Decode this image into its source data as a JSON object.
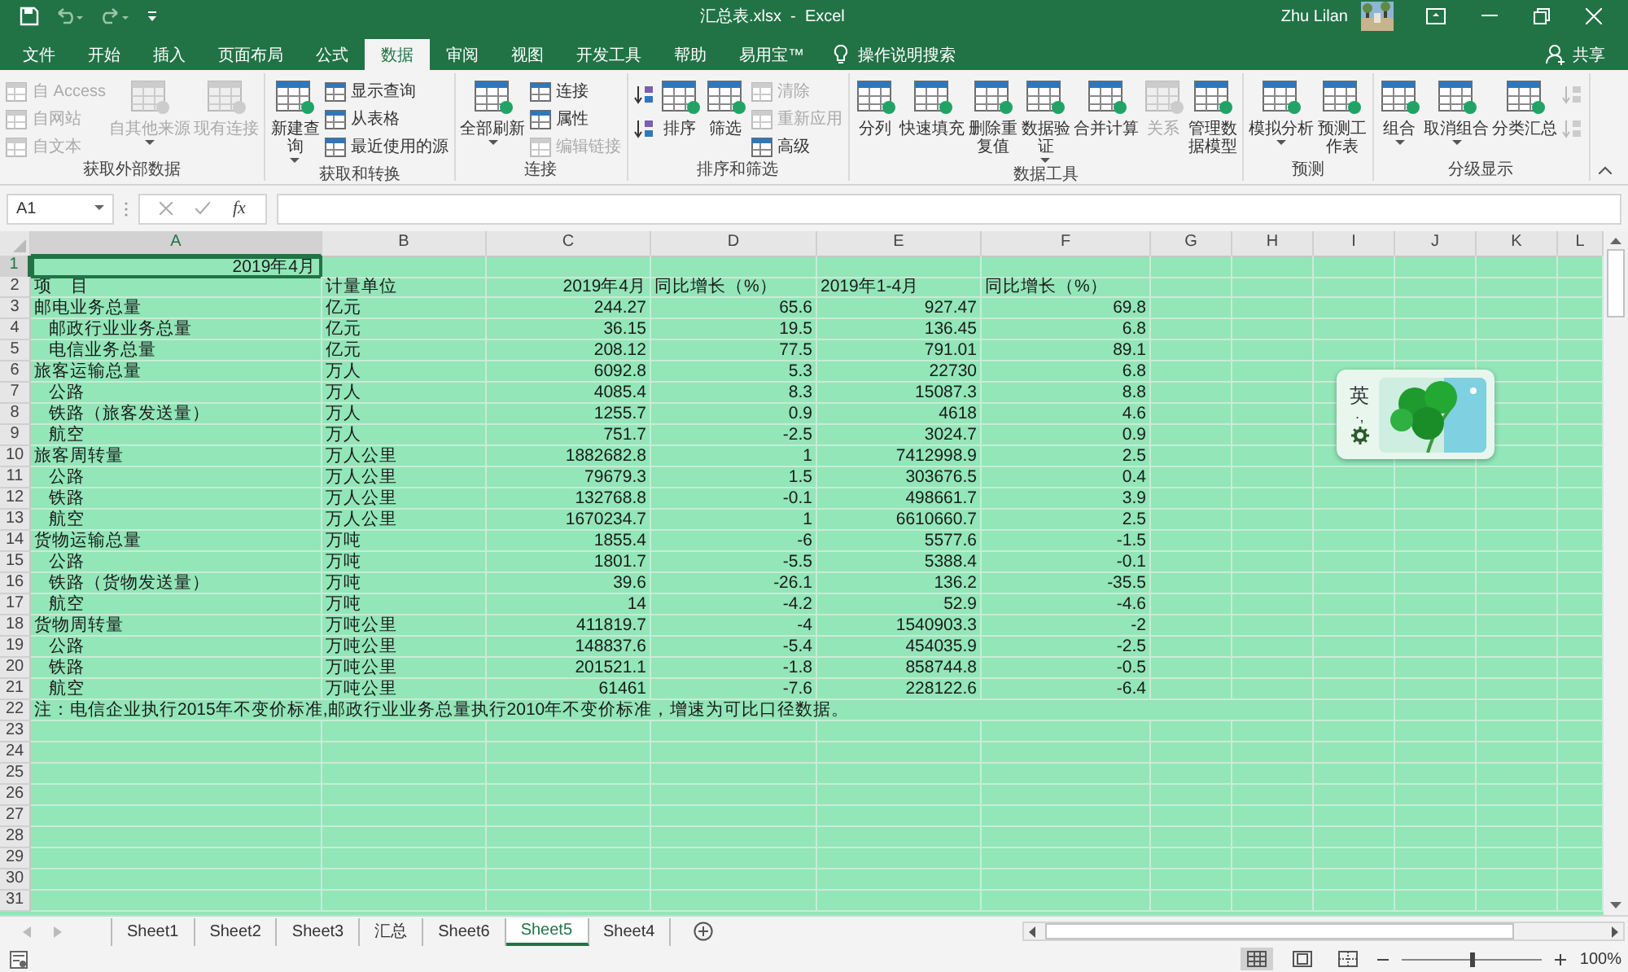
{
  "window": {
    "title": "汇总表.xlsx  -  Excel",
    "user": "Zhu Lilan"
  },
  "ribbon_tabs": [
    {
      "label": "文件",
      "selected": false
    },
    {
      "label": "开始",
      "selected": false
    },
    {
      "label": "插入",
      "selected": false
    },
    {
      "label": "页面布局",
      "selected": false
    },
    {
      "label": "公式",
      "selected": false
    },
    {
      "label": "数据",
      "selected": true
    },
    {
      "label": "审阅",
      "selected": false
    },
    {
      "label": "视图",
      "selected": false
    },
    {
      "label": "开发工具",
      "selected": false
    },
    {
      "label": "帮助",
      "selected": false
    },
    {
      "label": "易用宝™",
      "selected": false
    }
  ],
  "tell_me": "操作说明搜索",
  "share": "共享",
  "ribbon_groups": [
    {
      "label": "获取外部数据",
      "columns": [
        [
          {
            "label": "自 Access",
            "kind": "small",
            "disabled": true
          },
          {
            "label": "自网站",
            "kind": "small",
            "disabled": true
          },
          {
            "label": "自文本",
            "kind": "small",
            "disabled": true
          }
        ],
        [
          {
            "label": "自其他来源",
            "kind": "large",
            "disabled": true,
            "dropdown": true
          }
        ],
        [
          {
            "label": "现有连接",
            "kind": "large",
            "disabled": true
          }
        ]
      ]
    },
    {
      "label": "获取和转换",
      "columns": [
        [
          {
            "label": "新建查询",
            "kind": "large",
            "disabled": false,
            "dropdown": true,
            "wrap": true
          }
        ],
        [
          {
            "label": "显示查询",
            "kind": "small",
            "disabled": false
          },
          {
            "label": "从表格",
            "kind": "small",
            "disabled": false
          },
          {
            "label": "最近使用的源",
            "kind": "small",
            "disabled": false
          }
        ]
      ]
    },
    {
      "label": "连接",
      "columns": [
        [
          {
            "label": "全部刷新",
            "kind": "large",
            "disabled": false,
            "dropdown": true
          }
        ],
        [
          {
            "label": "连接",
            "kind": "small",
            "disabled": false
          },
          {
            "label": "属性",
            "kind": "small",
            "disabled": false
          },
          {
            "label": "编辑链接",
            "kind": "small",
            "disabled": true
          }
        ]
      ]
    },
    {
      "label": "排序和筛选",
      "columns": [
        [
          {
            "kind": "icon",
            "disabled": false
          },
          {
            "kind": "icon",
            "disabled": false
          }
        ],
        [
          {
            "label": "排序",
            "kind": "large",
            "disabled": false
          }
        ],
        [
          {
            "label": "筛选",
            "kind": "large",
            "disabled": false
          }
        ],
        [
          {
            "label": "清除",
            "kind": "small",
            "disabled": true
          },
          {
            "label": "重新应用",
            "kind": "small",
            "disabled": true
          },
          {
            "label": "高级",
            "kind": "small",
            "disabled": false
          }
        ]
      ]
    },
    {
      "label": "数据工具",
      "columns": [
        [
          {
            "label": "分列",
            "kind": "large",
            "disabled": false
          }
        ],
        [
          {
            "label": "快速填充",
            "kind": "large",
            "disabled": false
          }
        ],
        [
          {
            "label": "删除重复值",
            "kind": "large",
            "disabled": false,
            "wrap": true
          }
        ],
        [
          {
            "label": "数据验证",
            "kind": "large",
            "disabled": false,
            "dropdown": true,
            "wrap": true
          }
        ],
        [
          {
            "label": "合并计算",
            "kind": "large",
            "disabled": false
          }
        ],
        [
          {
            "label": "关系",
            "kind": "large",
            "disabled": true
          }
        ],
        [
          {
            "label": "管理数据模型",
            "kind": "large",
            "disabled": false,
            "wrap": true
          }
        ]
      ]
    },
    {
      "label": "预测",
      "columns": [
        [
          {
            "label": "模拟分析",
            "kind": "large",
            "disabled": false,
            "dropdown": true
          }
        ],
        [
          {
            "label": "预测工作表",
            "kind": "large",
            "disabled": false,
            "wrap": true
          }
        ]
      ]
    },
    {
      "label": "分级显示",
      "columns": [
        [
          {
            "label": "组合",
            "kind": "large",
            "disabled": false,
            "dropdown": true
          }
        ],
        [
          {
            "label": "取消组合",
            "kind": "large",
            "disabled": false,
            "dropdown": true
          }
        ],
        [
          {
            "label": "分类汇总",
            "kind": "large",
            "disabled": false
          }
        ],
        [
          {
            "kind": "icon",
            "disabled": true
          },
          {
            "kind": "icon",
            "disabled": true
          }
        ]
      ]
    }
  ],
  "formula_bar": {
    "name_box": "A1",
    "function_label": "fx"
  },
  "sheet": {
    "columns": [
      {
        "label": "A",
        "selected": true
      },
      {
        "label": "B",
        "selected": false
      },
      {
        "label": "C",
        "selected": false
      },
      {
        "label": "D",
        "selected": false
      },
      {
        "label": "E",
        "selected": false
      },
      {
        "label": "F",
        "selected": false
      },
      {
        "label": "G",
        "selected": false
      },
      {
        "label": "H",
        "selected": false
      },
      {
        "label": "I",
        "selected": false
      },
      {
        "label": "J",
        "selected": false
      },
      {
        "label": "K",
        "selected": false
      },
      {
        "label": "L",
        "selected": false
      }
    ],
    "rows": [
      {
        "number": "1",
        "selected": true,
        "kind": "title",
        "cells": [
          "2019年4月"
        ]
      },
      {
        "number": "2",
        "selected": false,
        "kind": "header",
        "cells": [
          "项    目",
          "计量单位",
          "2019年4月",
          "同比增长（%）",
          "2019年1-4月",
          "同比增长（%）"
        ]
      },
      {
        "number": "3",
        "selected": false,
        "kind": "data",
        "indent": false,
        "cells": [
          "邮电业务总量",
          "亿元",
          "244.27",
          "65.6",
          "927.47",
          "69.8"
        ]
      },
      {
        "number": "4",
        "selected": false,
        "kind": "data",
        "indent": true,
        "cells": [
          "邮政行业业务总量",
          "亿元",
          "36.15",
          "19.5",
          "136.45",
          "6.8"
        ]
      },
      {
        "number": "5",
        "selected": false,
        "kind": "data",
        "indent": true,
        "cells": [
          "电信业务总量",
          "亿元",
          "208.12",
          "77.5",
          "791.01",
          "89.1"
        ]
      },
      {
        "number": "6",
        "selected": false,
        "kind": "data",
        "indent": false,
        "cells": [
          "旅客运输总量",
          "万人",
          "6092.8",
          "5.3",
          "22730",
          "6.8"
        ]
      },
      {
        "number": "7",
        "selected": false,
        "kind": "data",
        "indent": true,
        "cells": [
          "公路",
          "万人",
          "4085.4",
          "8.3",
          "15087.3",
          "8.8"
        ]
      },
      {
        "number": "8",
        "selected": false,
        "kind": "data",
        "indent": true,
        "cells": [
          "铁路（旅客发送量）",
          "万人",
          "1255.7",
          "0.9",
          "4618",
          "4.6"
        ]
      },
      {
        "number": "9",
        "selected": false,
        "kind": "data",
        "indent": true,
        "cells": [
          "航空",
          "万人",
          "751.7",
          "-2.5",
          "3024.7",
          "0.9"
        ]
      },
      {
        "number": "10",
        "selected": false,
        "kind": "data",
        "indent": false,
        "cells": [
          "旅客周转量",
          "万人公里",
          "1882682.8",
          "1",
          "7412998.9",
          "2.5"
        ]
      },
      {
        "number": "11",
        "selected": false,
        "kind": "data",
        "indent": true,
        "cells": [
          "公路",
          "万人公里",
          "79679.3",
          "1.5",
          "303676.5",
          "0.4"
        ]
      },
      {
        "number": "12",
        "selected": false,
        "kind": "data",
        "indent": true,
        "cells": [
          "铁路",
          "万人公里",
          "132768.8",
          "-0.1",
          "498661.7",
          "3.9"
        ]
      },
      {
        "number": "13",
        "selected": false,
        "kind": "data",
        "indent": true,
        "cells": [
          "航空",
          "万人公里",
          "1670234.7",
          "1",
          "6610660.7",
          "2.5"
        ]
      },
      {
        "number": "14",
        "selected": false,
        "kind": "data",
        "indent": false,
        "cells": [
          "货物运输总量",
          "万吨",
          "1855.4",
          "-6",
          "5577.6",
          "-1.5"
        ]
      },
      {
        "number": "15",
        "selected": false,
        "kind": "data",
        "indent": true,
        "cells": [
          "公路",
          "万吨",
          "1801.7",
          "-5.5",
          "5388.4",
          "-0.1"
        ]
      },
      {
        "number": "16",
        "selected": false,
        "kind": "data",
        "indent": true,
        "cells": [
          "铁路（货物发送量）",
          "万吨",
          "39.6",
          "-26.1",
          "136.2",
          "-35.5"
        ]
      },
      {
        "number": "17",
        "selected": false,
        "kind": "data",
        "indent": true,
        "cells": [
          "航空",
          "万吨",
          "14",
          "-4.2",
          "52.9",
          "-4.6"
        ]
      },
      {
        "number": "18",
        "selected": false,
        "kind": "data",
        "indent": false,
        "cells": [
          "货物周转量",
          "万吨公里",
          "411819.7",
          "-4",
          "1540903.3",
          "-2"
        ]
      },
      {
        "number": "19",
        "selected": false,
        "kind": "data",
        "indent": true,
        "cells": [
          "公路",
          "万吨公里",
          "148837.6",
          "-5.4",
          "454035.9",
          "-2.5"
        ]
      },
      {
        "number": "20",
        "selected": false,
        "kind": "data",
        "indent": true,
        "cells": [
          "铁路",
          "万吨公里",
          "201521.1",
          "-1.8",
          "858744.8",
          "-0.5"
        ]
      },
      {
        "number": "21",
        "selected": false,
        "kind": "data",
        "indent": true,
        "cells": [
          "航空",
          "万吨公里",
          "61461",
          "-7.6",
          "228122.6",
          "-6.4"
        ]
      },
      {
        "number": "22",
        "selected": false,
        "kind": "note",
        "cells": [
          "注：电信企业执行2015年不变价标准,邮政行业业务总量执行2010年不变价标准，增速为可比口径数据。"
        ]
      },
      {
        "number": "23",
        "selected": false,
        "kind": "blank"
      },
      {
        "number": "24",
        "selected": false,
        "kind": "blank"
      },
      {
        "number": "25",
        "selected": false,
        "kind": "blank"
      },
      {
        "number": "26",
        "selected": false,
        "kind": "blank"
      },
      {
        "number": "27",
        "selected": false,
        "kind": "blank"
      },
      {
        "number": "28",
        "selected": false,
        "kind": "blank"
      },
      {
        "number": "29",
        "selected": false,
        "kind": "blank"
      },
      {
        "number": "30",
        "selected": false,
        "kind": "blank"
      },
      {
        "number": "31",
        "selected": false,
        "kind": "blank"
      }
    ]
  },
  "ime_widget": {
    "mode": "英",
    "punctuation": "·,"
  },
  "sheet_tabs": [
    {
      "label": "Sheet1",
      "selected": false
    },
    {
      "label": "Sheet2",
      "selected": false
    },
    {
      "label": "Sheet3",
      "selected": false
    },
    {
      "label": "汇总",
      "selected": false
    },
    {
      "label": "Sheet6",
      "selected": false
    },
    {
      "label": "Sheet5",
      "selected": true
    },
    {
      "label": "Sheet4",
      "selected": false
    }
  ],
  "status_bar": {
    "views": [
      {
        "kind": "normal",
        "selected": true
      },
      {
        "kind": "layout",
        "selected": false
      },
      {
        "kind": "break",
        "selected": false
      }
    ],
    "zoom": {
      "level": 0.5,
      "reading": "100%"
    }
  }
}
